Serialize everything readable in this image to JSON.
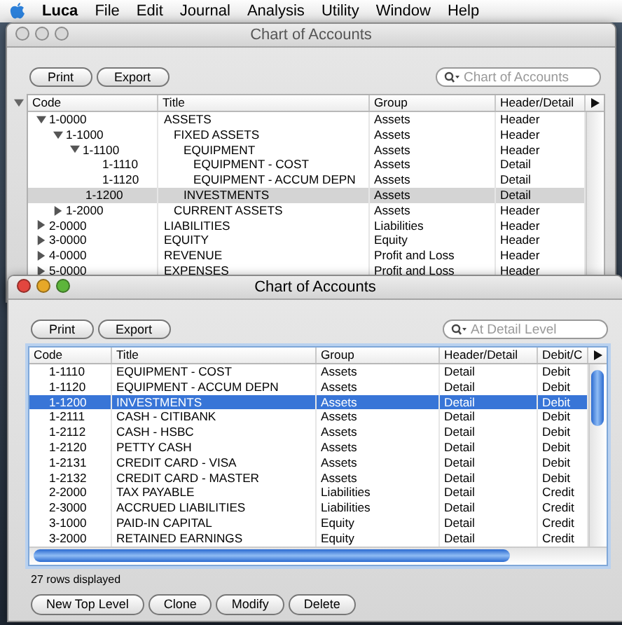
{
  "menubar": {
    "app": "Luca",
    "items": [
      "File",
      "Edit",
      "Journal",
      "Analysis",
      "Utility",
      "Window",
      "Help"
    ]
  },
  "windows": [
    {
      "title": "Chart of Accounts",
      "active": false,
      "buttons": [
        "Print",
        "Export"
      ],
      "search": {
        "placeholder": "Chart of Accounts"
      },
      "table": {
        "columns": [
          "Code",
          "Title",
          "Group",
          "Header/Detail"
        ],
        "rows": [
          {
            "code": "1-0000",
            "title": "ASSETS",
            "group": "Assets",
            "type": "Header",
            "expanded": true,
            "selected": false,
            "children": [
              {
                "code": "1-1000",
                "title": "FIXED ASSETS",
                "group": "Assets",
                "type": "Header",
                "expanded": true,
                "selected": false,
                "children": [
                  {
                    "code": "1-1100",
                    "title": "EQUIPMENT",
                    "group": "Assets",
                    "type": "Header",
                    "expanded": true,
                    "selected": false,
                    "children": [
                      {
                        "code": "1-1110",
                        "title": "EQUIPMENT - COST",
                        "group": "Assets",
                        "type": "Detail",
                        "selected": false
                      },
                      {
                        "code": "1-1120",
                        "title": "EQUIPMENT - ACCUM DEPN",
                        "group": "Assets",
                        "type": "Detail",
                        "selected": false
                      }
                    ]
                  },
                  {
                    "code": "1-1200",
                    "title": "INVESTMENTS",
                    "group": "Assets",
                    "type": "Detail",
                    "selected": true
                  }
                ]
              },
              {
                "code": "1-2000",
                "title": "CURRENT ASSETS",
                "group": "Assets",
                "type": "Header",
                "expanded": false,
                "selected": false
              }
            ]
          },
          {
            "code": "2-0000",
            "title": "LIABILITIES",
            "group": "Liabilities",
            "type": "Header",
            "expanded": false,
            "selected": false
          },
          {
            "code": "3-0000",
            "title": "EQUITY",
            "group": "Equity",
            "type": "Header",
            "expanded": false,
            "selected": false
          },
          {
            "code": "4-0000",
            "title": "REVENUE",
            "group": "Profit and Loss",
            "type": "Header",
            "expanded": false,
            "selected": false
          },
          {
            "code": "5-0000",
            "title": "EXPENSES",
            "group": "Profit and Loss",
            "type": "Header",
            "expanded": false,
            "selected": false
          }
        ]
      }
    },
    {
      "title": "Chart of Accounts",
      "active": true,
      "buttons": [
        "Print",
        "Export"
      ],
      "search": {
        "placeholder": "At Detail Level"
      },
      "table": {
        "columns": [
          "Code",
          "Title",
          "Group",
          "Header/Detail",
          "Debit/C"
        ],
        "rows": [
          {
            "code": "1-1110",
            "title": "EQUIPMENT - COST",
            "group": "Assets",
            "type": "Detail",
            "side": "Debit",
            "selected": false
          },
          {
            "code": "1-1120",
            "title": "EQUIPMENT - ACCUM DEPN",
            "group": "Assets",
            "type": "Detail",
            "side": "Debit",
            "selected": false
          },
          {
            "code": "1-1200",
            "title": "INVESTMENTS",
            "group": "Assets",
            "type": "Detail",
            "side": "Debit",
            "selected": true
          },
          {
            "code": "1-2111",
            "title": "CASH - CITIBANK",
            "group": "Assets",
            "type": "Detail",
            "side": "Debit",
            "selected": false
          },
          {
            "code": "1-2112",
            "title": "CASH - HSBC",
            "group": "Assets",
            "type": "Detail",
            "side": "Debit",
            "selected": false
          },
          {
            "code": "1-2120",
            "title": "PETTY CASH",
            "group": "Assets",
            "type": "Detail",
            "side": "Debit",
            "selected": false
          },
          {
            "code": "1-2131",
            "title": "CREDIT CARD - VISA",
            "group": "Assets",
            "type": "Detail",
            "side": "Debit",
            "selected": false
          },
          {
            "code": "1-2132",
            "title": "CREDIT CARD - MASTER",
            "group": "Assets",
            "type": "Detail",
            "side": "Debit",
            "selected": false
          },
          {
            "code": "2-2000",
            "title": "TAX PAYABLE",
            "group": "Liabilities",
            "type": "Detail",
            "side": "Credit",
            "selected": false
          },
          {
            "code": "2-3000",
            "title": "ACCRUED LIABILITIES",
            "group": "Liabilities",
            "type": "Detail",
            "side": "Credit",
            "selected": false
          },
          {
            "code": "3-1000",
            "title": "PAID-IN CAPITAL",
            "group": "Equity",
            "type": "Detail",
            "side": "Credit",
            "selected": false
          },
          {
            "code": "3-2000",
            "title": "RETAINED EARNINGS",
            "group": "Equity",
            "type": "Detail",
            "side": "Credit",
            "selected": false
          }
        ]
      },
      "status": "27 rows displayed",
      "footer_buttons": [
        "New Top Level",
        "Clone",
        "Modify",
        "Delete"
      ]
    }
  ]
}
